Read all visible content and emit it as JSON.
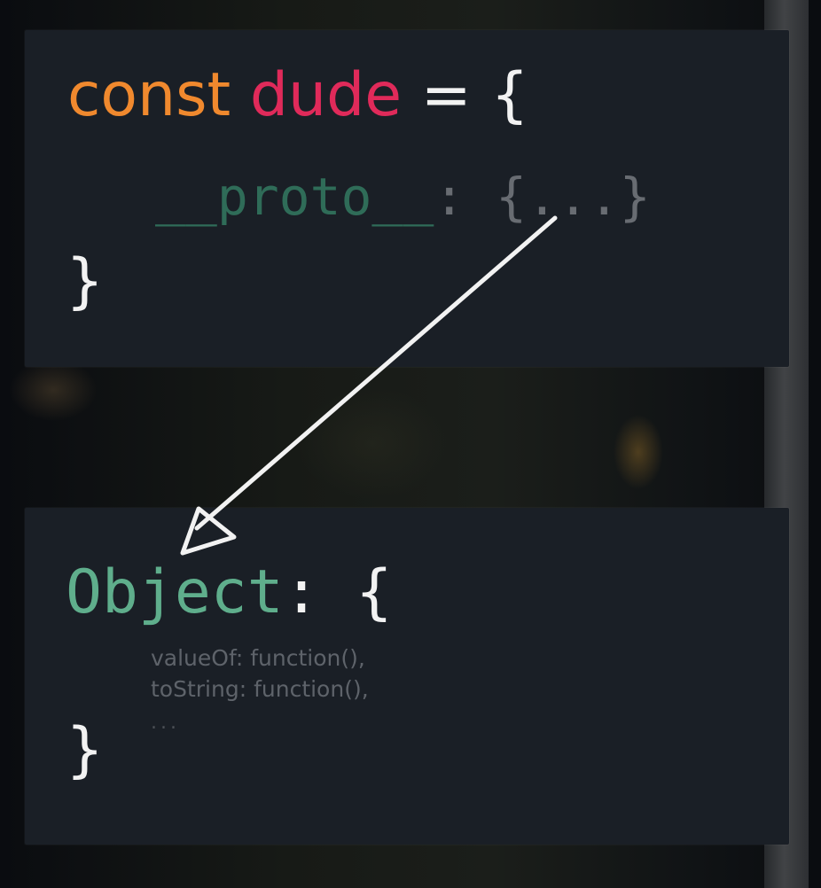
{
  "top_block": {
    "keyword": "const",
    "variable": "dude",
    "operator": "=",
    "open_brace": "{",
    "proto_key": "__proto__",
    "proto_colon": ":",
    "proto_value": "{...}",
    "close_brace": "}"
  },
  "bottom_block": {
    "name": "Object",
    "colon": ":",
    "open_brace": "{",
    "members": [
      "valueOf: function(),",
      "toString: function(),",
      "..."
    ],
    "close_brace": "}"
  },
  "colors": {
    "keyword": "#f0892e",
    "variable": "#e02a5a",
    "proto_key": "#2f6c58",
    "object_name": "#5fae8c",
    "arrow": "#f2f2f2"
  },
  "icons": {
    "arrow": "arrow-icon"
  }
}
